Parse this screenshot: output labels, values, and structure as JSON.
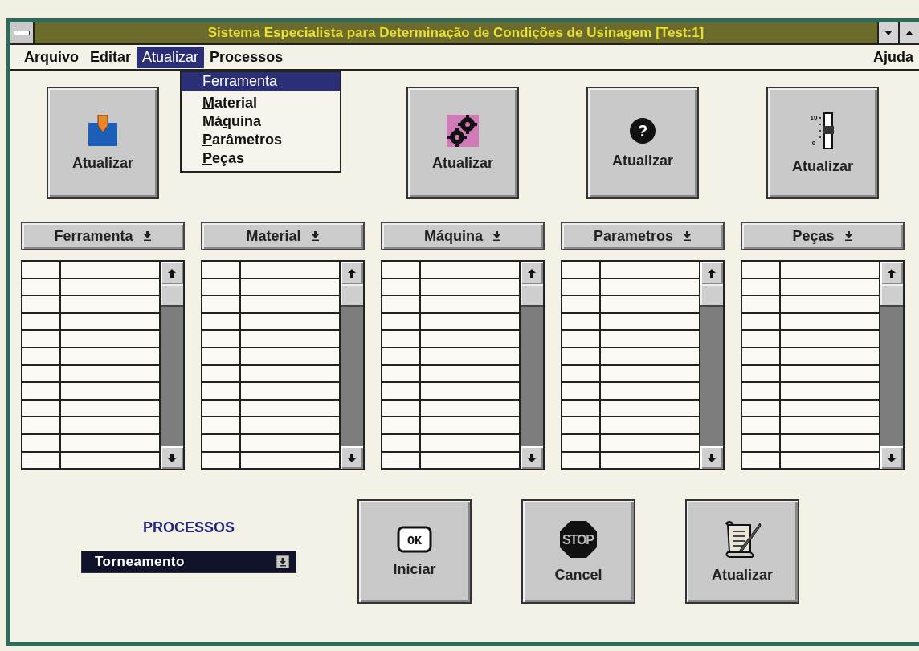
{
  "window": {
    "title": "Sistema Especialista para Determinação de Condições de Usinagem [Test:1]"
  },
  "menu_bar": [
    {
      "key": "A",
      "after": "rquivo",
      "selected": false
    },
    {
      "key": "E",
      "after": "ditar",
      "selected": false
    },
    {
      "key": "A",
      "after": "tualizar",
      "selected": true
    },
    {
      "key": "P",
      "after": "rocessos",
      "selected": false
    },
    {
      "before": "Aju",
      "key": "d",
      "after": "a",
      "selected": false
    }
  ],
  "open_menu": {
    "items": [
      {
        "key": "F",
        "after": "erramenta",
        "selected": true
      },
      {
        "key": "M",
        "after": "aterial",
        "selected": false
      },
      {
        "before": "Má",
        "key": "q",
        "after": "uina",
        "selected": false
      },
      {
        "key": "P",
        "after": "arâmetros",
        "selected": false
      },
      {
        "key": "P",
        "after": "eças",
        "selected": false
      }
    ]
  },
  "toolbar": [
    {
      "label": "Atualizar",
      "kind": "pencil"
    },
    {
      "label": "Atualizar",
      "kind": "gears"
    },
    {
      "label": "Atualizar",
      "kind": "question",
      "icon_text": [
        "?"
      ]
    },
    {
      "label": "Atualizar",
      "kind": "slider",
      "icon_text": [
        "10",
        "0"
      ]
    }
  ],
  "panels": [
    {
      "label": "Ferramenta"
    },
    {
      "label": "Material"
    },
    {
      "label": "Máquina"
    },
    {
      "label": "Parametros"
    },
    {
      "label": "Peças"
    }
  ],
  "processos": {
    "label": "PROCESSOS",
    "value": "Torneamento"
  },
  "actions": [
    {
      "label": "Iniciar",
      "kind": "ok",
      "icon_text": [
        "OK"
      ]
    },
    {
      "label": "Cancel",
      "kind": "stop",
      "icon_text": [
        "STOP"
      ]
    },
    {
      "label": "Atualizar",
      "kind": "scroll"
    }
  ]
}
